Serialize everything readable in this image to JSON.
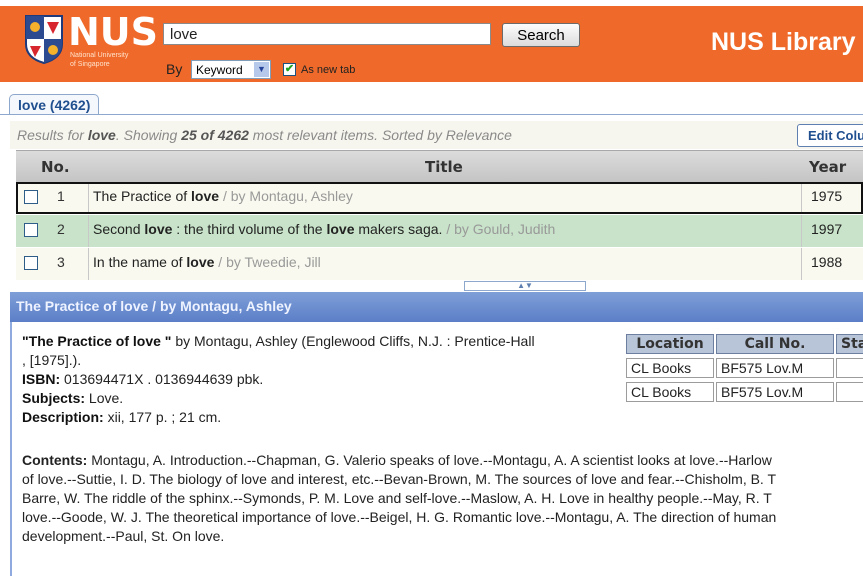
{
  "header": {
    "logo_text": "NUS",
    "logo_sub1": "National University",
    "logo_sub2": "of Singapore",
    "search_value": "love",
    "search_button": "Search",
    "by_label": "By",
    "by_select": "Keyword",
    "new_tab_label": "As new tab",
    "library_title": "NUS Library"
  },
  "tab": {
    "label": "love (4262)"
  },
  "results": {
    "prefix": "Results for ",
    "query": "love",
    "mid": ". Showing ",
    "count": "25 of 4262",
    "suffix": " most relevant items. Sorted by Relevance",
    "edit_button": "Edit Columns"
  },
  "table": {
    "headers": {
      "no": "No.",
      "title": "Title",
      "year": "Year"
    },
    "rows": [
      {
        "no": "1",
        "title_parts": [
          "The Practice of ",
          "love",
          ""
        ],
        "author": " / by Montagu, Ashley",
        "year": "1975"
      },
      {
        "no": "2",
        "title_parts": [
          "Second ",
          "love",
          " : the third volume of the ",
          "love",
          " makers saga."
        ],
        "author": " / by Gould, Judith",
        "year": "1997"
      },
      {
        "no": "3",
        "title_parts": [
          "In the name of ",
          "love",
          ""
        ],
        "author": " / by Tweedie, Jill",
        "year": "1988"
      }
    ]
  },
  "detail": {
    "bar_title": "The Practice of love / by Montagu, Ashley",
    "title_quoted": "\"The Practice of love \"",
    "by_text": " by Montagu, Ashley (Englewood Cliffs, N.J. : Prentice-Hall",
    "by_text2": ", [1975].).",
    "isbn_label": "ISBN:",
    "isbn_value": " 013694471X . 0136944639 pbk.",
    "subjects_label": "Subjects:",
    "subjects_value": " Love.",
    "description_label": "Description:",
    "description_value": " xii, 177 p. ; 21 cm.",
    "contents_label": "Contents:",
    "contents_lines": [
      " Montagu, A. Introduction.--Chapman, G. Valerio speaks of love.--Montagu, A. A scientist looks at love.--Harlow",
      "of love.--Suttie, I. D. The biology of love and interest, etc.--Bevan-Brown, M. The sources of love and fear.--Chisholm, B. T",
      "Barre, W. The riddle of the sphinx.--Symonds, P. M. Love and self-love.--Maslow, A. H. Love in healthy people.--May, R. T",
      "love.--Goode, W. J. The theoretical importance of love.--Beigel, H. G. Romantic love.--Montagu, A. The direction of human",
      "development.--Paul, St. On love."
    ],
    "location_table": {
      "headers": [
        "Location",
        "Call No.",
        "Sta"
      ],
      "rows": [
        [
          "CL Books",
          "BF575 Lov.M",
          ""
        ],
        [
          "CL Books",
          "BF575 Lov.M",
          ""
        ]
      ]
    }
  }
}
